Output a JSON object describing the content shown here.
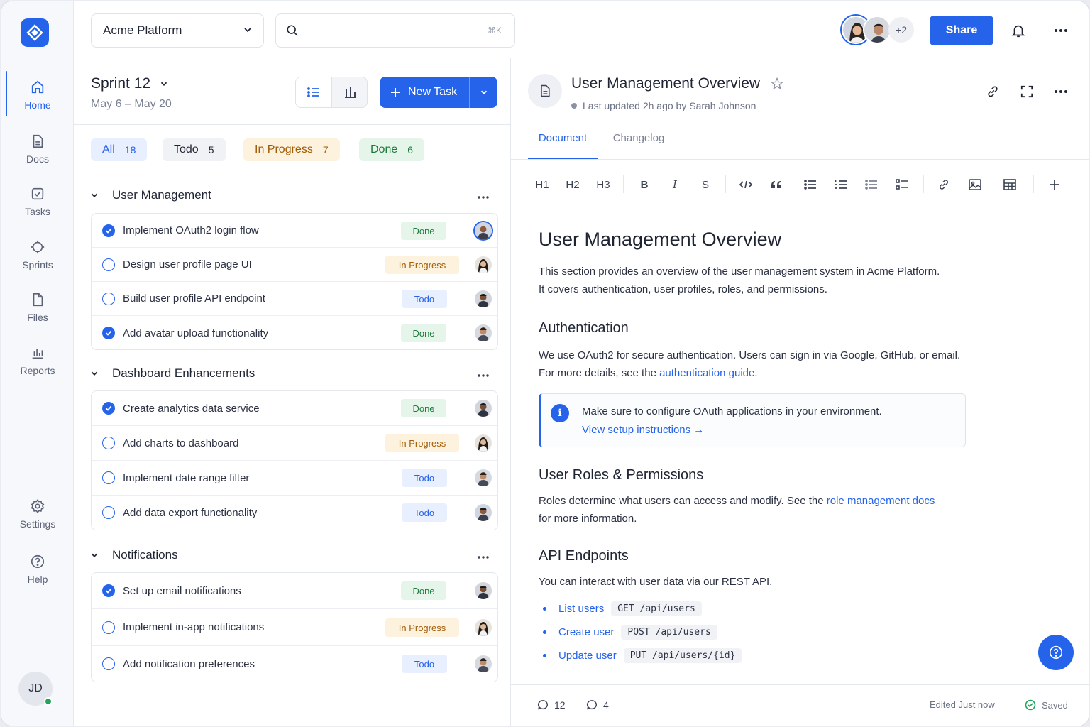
{
  "workspace": {
    "name": "Acme Platform"
  },
  "search": {
    "placeholder": "",
    "shortcut": "⌘K"
  },
  "header": {
    "more_avatars": "+2",
    "share_label": "Share"
  },
  "sidebar": {
    "items": [
      {
        "label": "Home"
      },
      {
        "label": "Docs"
      },
      {
        "label": "Tasks"
      },
      {
        "label": "Sprints"
      },
      {
        "label": "Files"
      },
      {
        "label": "Reports"
      },
      {
        "label": "Settings"
      },
      {
        "label": "Help"
      }
    ],
    "user_initials": "JD"
  },
  "sprint": {
    "title": "Sprint 12",
    "dates": "May 6 – May 20",
    "new_task_label": "New Task"
  },
  "filters": [
    {
      "label": "All",
      "count": "18"
    },
    {
      "label": "Todo",
      "count": "5"
    },
    {
      "label": "In Progress",
      "count": "7"
    },
    {
      "label": "Done",
      "count": "6"
    }
  ],
  "groups": [
    {
      "name": "User Management",
      "tasks": [
        {
          "title": "Implement OAuth2 login flow",
          "status": "Done"
        },
        {
          "title": "Design user profile page UI",
          "status": "In Progress"
        },
        {
          "title": "Build user profile API endpoint",
          "status": "Todo"
        },
        {
          "title": "Add avatar upload functionality",
          "status": "Done"
        }
      ]
    },
    {
      "name": "Dashboard Enhancements",
      "tasks": [
        {
          "title": "Create analytics data service",
          "status": "Done"
        },
        {
          "title": "Add charts to dashboard",
          "status": "In Progress"
        },
        {
          "title": "Implement date range filter",
          "status": "Todo"
        },
        {
          "title": "Add data export functionality",
          "status": "Todo"
        }
      ]
    },
    {
      "name": "Notifications",
      "tasks": [
        {
          "title": "Set up email notifications",
          "status": "Done"
        },
        {
          "title": "Implement in-app notifications",
          "status": "In Progress"
        },
        {
          "title": "Add notification preferences",
          "status": "Todo"
        }
      ]
    }
  ],
  "doc": {
    "title": "User Management Overview",
    "meta": "Last updated 2h ago by Sarah Johnson",
    "tabs": [
      "Document",
      "Changelog"
    ],
    "toolbar": [
      "H1",
      "H2",
      "H3",
      "B",
      "I",
      "S"
    ],
    "h1": "User Management Overview",
    "intro_1": "This section provides an overview of the user management system in Acme Platform.",
    "intro_2": "It covers authentication, user profiles, roles, and permissions.",
    "auth_heading": "Authentication",
    "auth_1": "We use OAuth2 for secure authentication. Users can sign in via Google, GitHub, or email.",
    "auth_2_prefix": "For more details, see the ",
    "auth_2_link": "authentication guide",
    "auth_2_suffix": ".",
    "callout_text": "Make sure to configure OAuth applications in your environment.",
    "callout_link": "View setup instructions →",
    "roles_heading": "User Roles & Permissions",
    "roles_1_prefix": "Roles determine what users can access and modify. See the ",
    "roles_1_link": "role management docs",
    "roles_2": "for more information.",
    "api_heading": "API Endpoints",
    "api_intro": "You can interact with user data via our REST API.",
    "api_items": [
      {
        "label": "List users",
        "code": "GET /api/users"
      },
      {
        "label": "Create user",
        "code": "POST /api/users"
      },
      {
        "label": "Update user",
        "code": "PUT /api/users/{id}"
      }
    ],
    "comments_count": "12",
    "replies_count": "4",
    "edited": "Edited Just now",
    "saved": "Saved"
  },
  "colors": {
    "accent": "#2563eb",
    "done": "#1e7a3d",
    "progress": "#a15c07"
  },
  "icons": [
    "logo-icon",
    "home-icon",
    "docs-icon",
    "tasks-icon",
    "sprints-icon",
    "files-icon",
    "reports-icon",
    "settings-icon",
    "help-icon",
    "search-icon",
    "bell-icon",
    "more-icon",
    "link-icon",
    "expand-icon",
    "star-icon",
    "document-icon",
    "comment-icon",
    "check-circle-icon"
  ]
}
